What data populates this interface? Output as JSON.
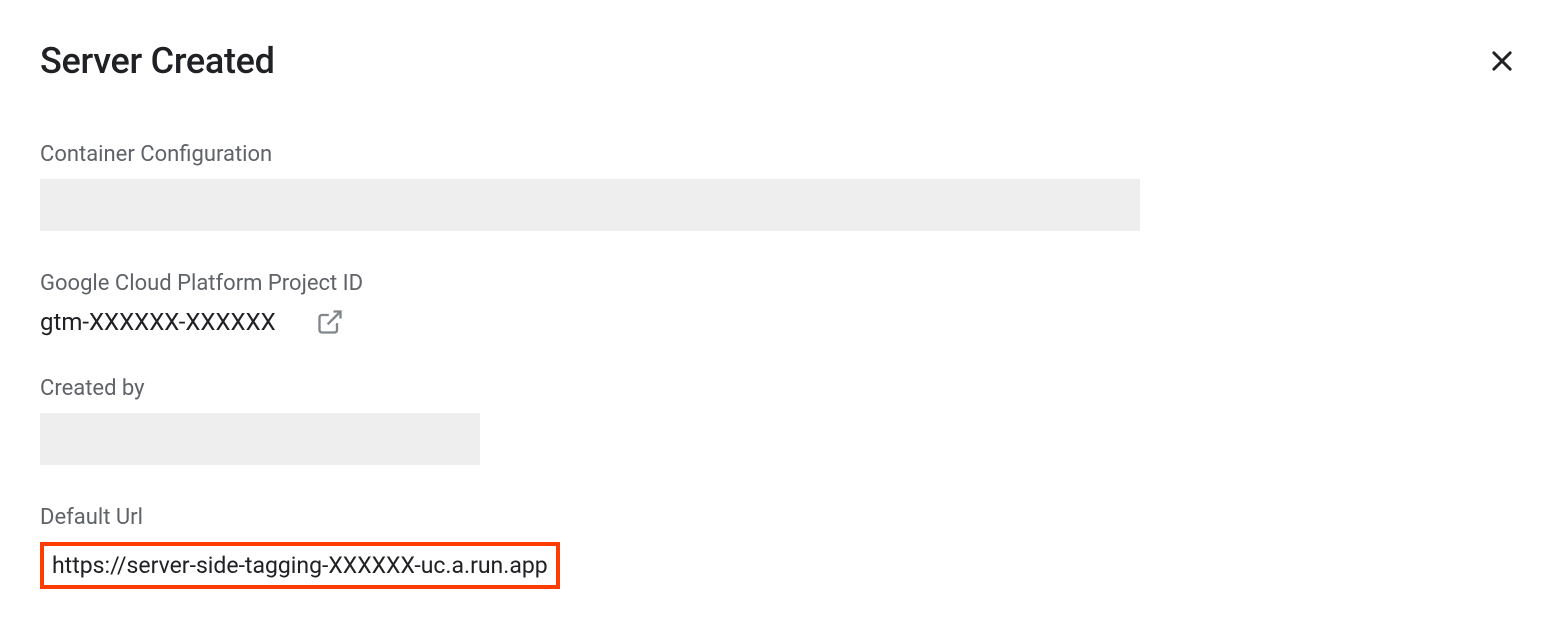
{
  "header": {
    "title": "Server Created"
  },
  "fields": {
    "containerConfig": {
      "label": "Container Configuration"
    },
    "projectId": {
      "label": "Google Cloud Platform Project ID",
      "value": "gtm-XXXXXX-XXXXXX"
    },
    "createdBy": {
      "label": "Created by"
    },
    "defaultUrl": {
      "label": "Default Url",
      "value": "https://server-side-tagging-XXXXXX-uc.a.run.app"
    }
  }
}
